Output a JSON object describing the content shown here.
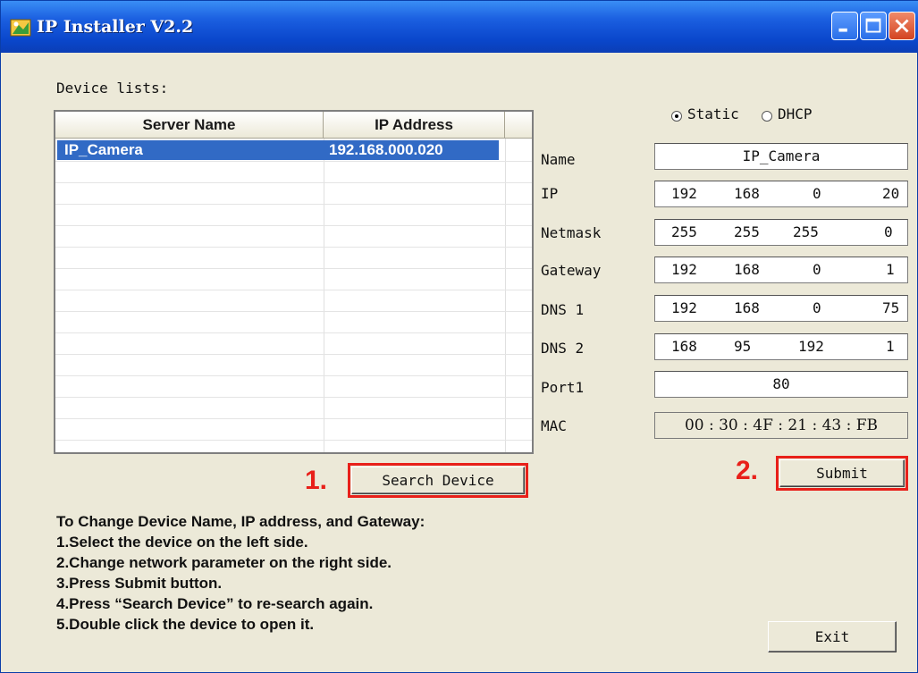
{
  "window": {
    "title": "IP Installer V2.2"
  },
  "device_list": {
    "label": "Device lists:",
    "columns": [
      "Server Name",
      "IP Address"
    ],
    "rows": [
      {
        "server_name": "IP_Camera",
        "ip_address": "192.168.000.020",
        "selected": true
      }
    ]
  },
  "mode": {
    "static_label": "Static",
    "dhcp_label": "DHCP",
    "selected": "Static"
  },
  "settings": {
    "name": {
      "label": "Name",
      "value": "IP_Camera"
    },
    "ip": {
      "label": "IP",
      "octets": [
        "192",
        "168",
        "0",
        "20"
      ]
    },
    "netmask": {
      "label": "Netmask",
      "octets": [
        "255",
        "255",
        "255",
        "0"
      ]
    },
    "gateway": {
      "label": "Gateway",
      "octets": [
        "192",
        "168",
        "0",
        "1"
      ]
    },
    "dns1": {
      "label": "DNS 1",
      "octets": [
        "192",
        "168",
        "0",
        "75"
      ]
    },
    "dns2": {
      "label": "DNS 2",
      "octets": [
        "168",
        "95",
        "192",
        "1"
      ]
    },
    "port1": {
      "label": "Port1",
      "value": "80"
    },
    "mac": {
      "label": "MAC",
      "value": "00 : 30 : 4F : 21 : 43 : FB"
    }
  },
  "buttons": {
    "search": "Search Device",
    "submit": "Submit",
    "exit": "Exit"
  },
  "annotations": {
    "step1": "1.",
    "step2": "2.",
    "highlight_color": "#e8201a"
  },
  "instructions": {
    "heading": "To Change Device Name, IP address, and Gateway:",
    "steps": [
      "1.Select the device on the left side.",
      "2.Change network parameter on the right side.",
      "3.Press Submit button.",
      "4.Press “Search Device” to re-search again.",
      "5.Double click the device to open it."
    ]
  },
  "colors": {
    "titlebar": "#0a47cc",
    "selection": "#316ac5",
    "face": "#ece9d8"
  }
}
